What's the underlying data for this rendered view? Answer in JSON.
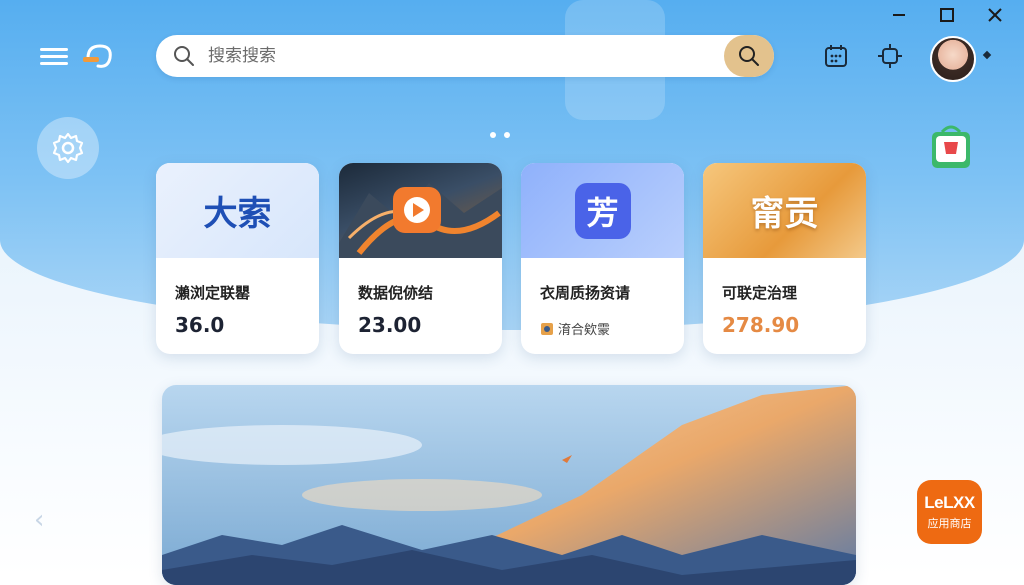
{
  "window_controls": {
    "minimize": "—",
    "maximize": "☐",
    "close": "✕"
  },
  "search": {
    "placeholder": "搜索搜索"
  },
  "cards": [
    {
      "thumb_text": "大索",
      "thumb_color": "#1e4fb5",
      "title": "瀨浏定联罌",
      "price": "36.0"
    },
    {
      "title": "数据倪㑊结",
      "price": "23.00"
    },
    {
      "thumb_text": "芳",
      "thumb_color": "#ffffff",
      "title": "衣周质扬资请",
      "sub": "淯合欸霥"
    },
    {
      "thumb_text": "甯贡",
      "thumb_color": "#ffffff",
      "title": "可联定治理",
      "price": "278.90"
    }
  ],
  "lenovo_store": {
    "brand": "LeLXX",
    "label": "应用商店"
  },
  "colors": {
    "sky": "#56aef0",
    "search_button": "#e3c28d",
    "lenovo": "#ee6a12",
    "price_highlight": "#e58a44"
  }
}
